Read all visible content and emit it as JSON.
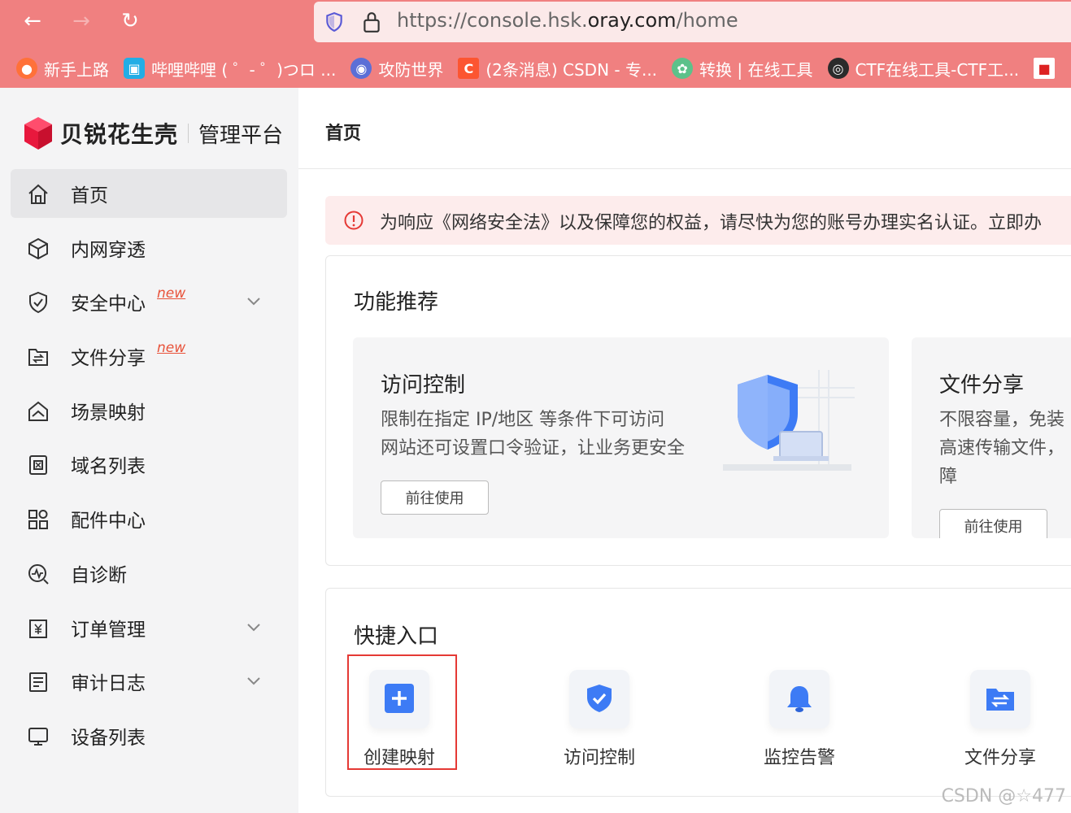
{
  "browser": {
    "url_prefix": "https://console.hsk.",
    "url_domain": "oray.com",
    "url_path": "/home",
    "bookmarks": [
      {
        "label": "新手上路",
        "icon": "firefox-icon",
        "color": "#ff7139"
      },
      {
        "label": "哔哩哔哩 ( ゜- ゜)つロ ...",
        "icon": "bilibili-icon",
        "color": "#23ade5"
      },
      {
        "label": "攻防世界",
        "icon": "globe-icon",
        "color": "#5b6fd6"
      },
      {
        "label": "(2条消息) CSDN - 专...",
        "icon": "csdn-icon",
        "color": "#fc5531"
      },
      {
        "label": "转换 | 在线工具",
        "icon": "puzzle-icon",
        "color": "#5cc18a"
      },
      {
        "label": "CTF在线工具-CTF工...",
        "icon": "ctf-icon",
        "color": "#2b2b2b"
      }
    ]
  },
  "sidebar": {
    "brand": "贝锐花生壳",
    "subtitle": "管理平台",
    "new_tag": "new",
    "items": [
      {
        "label": "首页",
        "icon": "home-icon"
      },
      {
        "label": "内网穿透",
        "icon": "cube-icon"
      },
      {
        "label": "安全中心",
        "icon": "shield-icon"
      },
      {
        "label": "文件分享",
        "icon": "folder-share-icon"
      },
      {
        "label": "场景映射",
        "icon": "scene-icon"
      },
      {
        "label": "域名列表",
        "icon": "domain-icon"
      },
      {
        "label": "配件中心",
        "icon": "apps-icon"
      },
      {
        "label": "自诊断",
        "icon": "diagnose-icon"
      },
      {
        "label": "订单管理",
        "icon": "order-icon"
      },
      {
        "label": "审计日志",
        "icon": "log-icon"
      },
      {
        "label": "设备列表",
        "icon": "device-icon"
      }
    ]
  },
  "main": {
    "page_title": "首页",
    "notice": "为响应《网络安全法》以及保障您的权益，请尽快为您的账号办理实名认证。立即办",
    "features": {
      "title": "功能推荐",
      "cards": [
        {
          "title": "访问控制",
          "desc1": "限制在指定 IP/地区 等条件下可访问",
          "desc2": "网站还可设置口令验证，让业务更安全",
          "button": "前往使用"
        },
        {
          "title": "文件分享",
          "desc1": "不限容量，免装",
          "desc2": "高速传输文件，",
          "desc3": "障",
          "button": "前往使用"
        }
      ]
    },
    "quick": {
      "title": "快捷入口",
      "items": [
        {
          "label": "创建映射",
          "icon": "plus-icon"
        },
        {
          "label": "访问控制",
          "icon": "shield-check-icon"
        },
        {
          "label": "监控告警",
          "icon": "bell-icon"
        },
        {
          "label": "文件分享",
          "icon": "folder-transfer-icon"
        }
      ]
    }
  },
  "watermark": "CSDN @☆477",
  "colors": {
    "chrome": "#f08080",
    "accent": "#3d7bf5",
    "danger": "#e53935",
    "new_tag": "#e8533b"
  }
}
